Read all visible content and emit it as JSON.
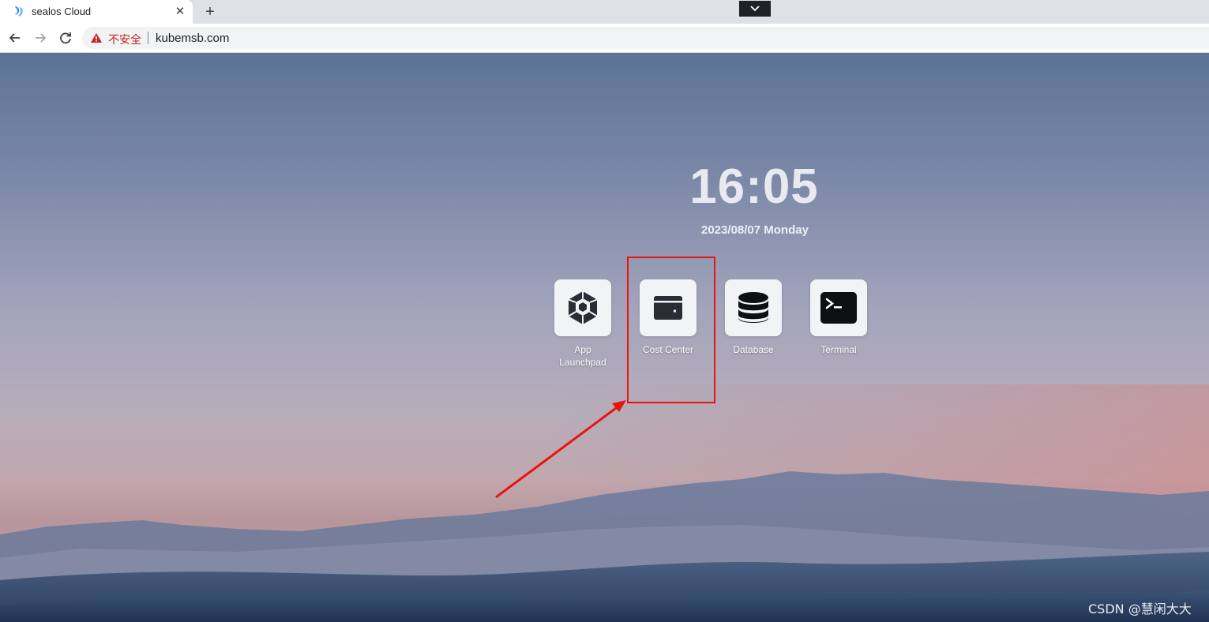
{
  "browser": {
    "tab": {
      "title": "sealos Cloud",
      "close_label": "✕"
    },
    "new_tab_label": "+",
    "toolbar": {
      "security_text": "不安全",
      "url": "kubemsb.com"
    }
  },
  "desktop": {
    "clock": {
      "time": "16:05",
      "date": "2023/08/07 Monday"
    },
    "apps": [
      {
        "label": "App\nLaunchpad",
        "icon": "hexagon-cube-icon"
      },
      {
        "label": "Cost Center",
        "icon": "wallet-icon"
      },
      {
        "label": "Database",
        "icon": "database-icon"
      },
      {
        "label": "Terminal",
        "icon": "terminal-icon"
      }
    ],
    "annotation": {
      "highlight_color": "#e8140f",
      "highlighted_app": "Cost Center"
    },
    "watermark": "CSDN @慧闲大大"
  }
}
